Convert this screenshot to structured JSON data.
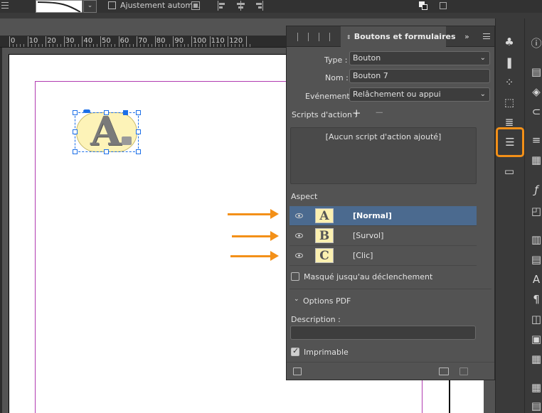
{
  "control_bar": {
    "autofit_label": "Ajustement autom..."
  },
  "ruler": {
    "labels": [
      "0",
      "10",
      "20",
      "30",
      "40",
      "50",
      "60",
      "70",
      "80",
      "90",
      "100",
      "110",
      "120"
    ]
  },
  "canvas": {
    "button_object": {
      "glyph": "A"
    }
  },
  "panel": {
    "title": "Boutons et formulaires",
    "more_label": "»",
    "type_label": "Type :",
    "type_value": "Bouton",
    "name_label": "Nom :",
    "name_value": "Bouton 7",
    "event_label": "Evénement :",
    "event_value": "Relâchement ou appui",
    "scripts_label": "Scripts d'action :",
    "no_script_text": "[Aucun script d'action ajouté]",
    "aspect_label": "Aspect",
    "aspect_states": [
      {
        "label": "[Normal]",
        "thumb": "A",
        "selected": true
      },
      {
        "label": "[Survol]",
        "thumb": "B",
        "selected": false
      },
      {
        "label": "[Clic]",
        "thumb": "C",
        "selected": false
      }
    ],
    "hidden_until_trigger_label": "Masqué jusqu'au déclenchement",
    "pdf_options_label": "Options PDF",
    "description_label": "Description :",
    "description_value": "",
    "printable_label": "Imprimable"
  },
  "colors": {
    "highlight": "#f39018",
    "selection": "#4b6a8f",
    "frame": "#1c6fe8",
    "margin": "#b13bb1"
  },
  "dock_icons": [
    "layers-icon",
    "pages-icon",
    "links-icon",
    "transform-icon",
    "buttons-forms-icon",
    "comments-icon"
  ]
}
